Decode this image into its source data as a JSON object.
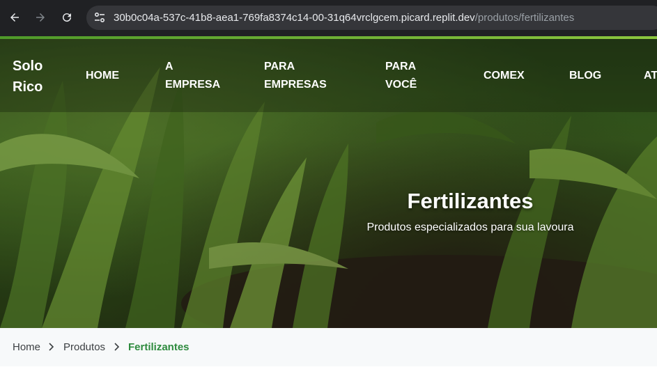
{
  "browser": {
    "url_host": "30b0c04a-537c-41b8-aea1-769fa8374c14-00-31q64vrclgcem.picard.replit.dev",
    "url_path": "/produtos/fertilizantes"
  },
  "colors": {
    "accent": "#8cc63f",
    "breadcrumb_active": "#2e8b3e"
  },
  "header": {
    "logo": "Solo Rico",
    "menu": [
      {
        "label": "HOME"
      },
      {
        "label": "A EMPRESA"
      },
      {
        "label": "PARA EMPRESAS"
      },
      {
        "label": "PARA VOCÊ"
      },
      {
        "label": "COMEX"
      },
      {
        "label": "BLOG"
      },
      {
        "label": "AT"
      }
    ]
  },
  "hero": {
    "title": "Fertilizantes",
    "subtitle": "Produtos especializados para sua lavoura"
  },
  "breadcrumb": {
    "items": [
      "Home",
      "Produtos",
      "Fertilizantes"
    ]
  }
}
